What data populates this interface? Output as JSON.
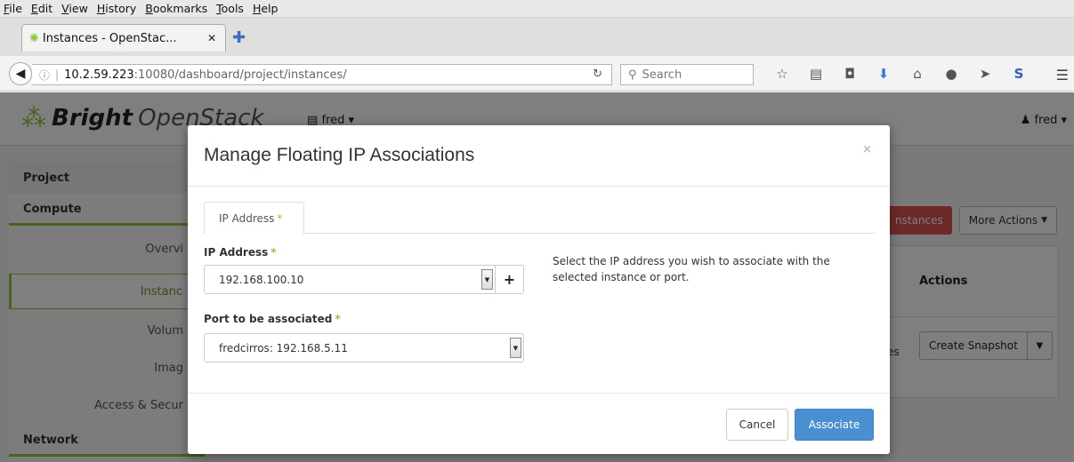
{
  "browser": {
    "menu": [
      "File",
      "Edit",
      "View",
      "History",
      "Bookmarks",
      "Tools",
      "Help"
    ],
    "tab_title": "Instances - OpenStac...",
    "url_host": "10.2.59.223",
    "url_path": ":10080/dashboard/project/instances/",
    "search_placeholder": "Search"
  },
  "app": {
    "brand_bold": "Bright",
    "brand_light": "OpenStack",
    "project_selector": "fred",
    "user_menu": "fred"
  },
  "sidebar": {
    "project": "Project",
    "compute": "Compute",
    "items": [
      "Overvi",
      "Instanc",
      "Volum",
      "Imag",
      "Access & Secur"
    ],
    "network": "Network"
  },
  "background": {
    "launch_label": "nstances",
    "more_actions": "More Actions",
    "actions_header": "Actions",
    "row_status": "es",
    "create_snapshot": "Create Snapshot"
  },
  "modal": {
    "title": "Manage Floating IP Associations",
    "close": "×",
    "tab_label": "IP Address",
    "required_mark": "*",
    "ip_label": "IP Address",
    "ip_value": "192.168.100.10",
    "add_label": "+",
    "port_label": "Port to be associated",
    "port_value": "fredcirros: 192.168.5.11",
    "help_text": "Select the IP address you wish to associate with the selected instance or port.",
    "cancel": "Cancel",
    "submit": "Associate"
  },
  "colors": {
    "accent_green": "#8cc63f",
    "primary_blue": "#4a90d0",
    "danger_red": "#d9534f"
  }
}
